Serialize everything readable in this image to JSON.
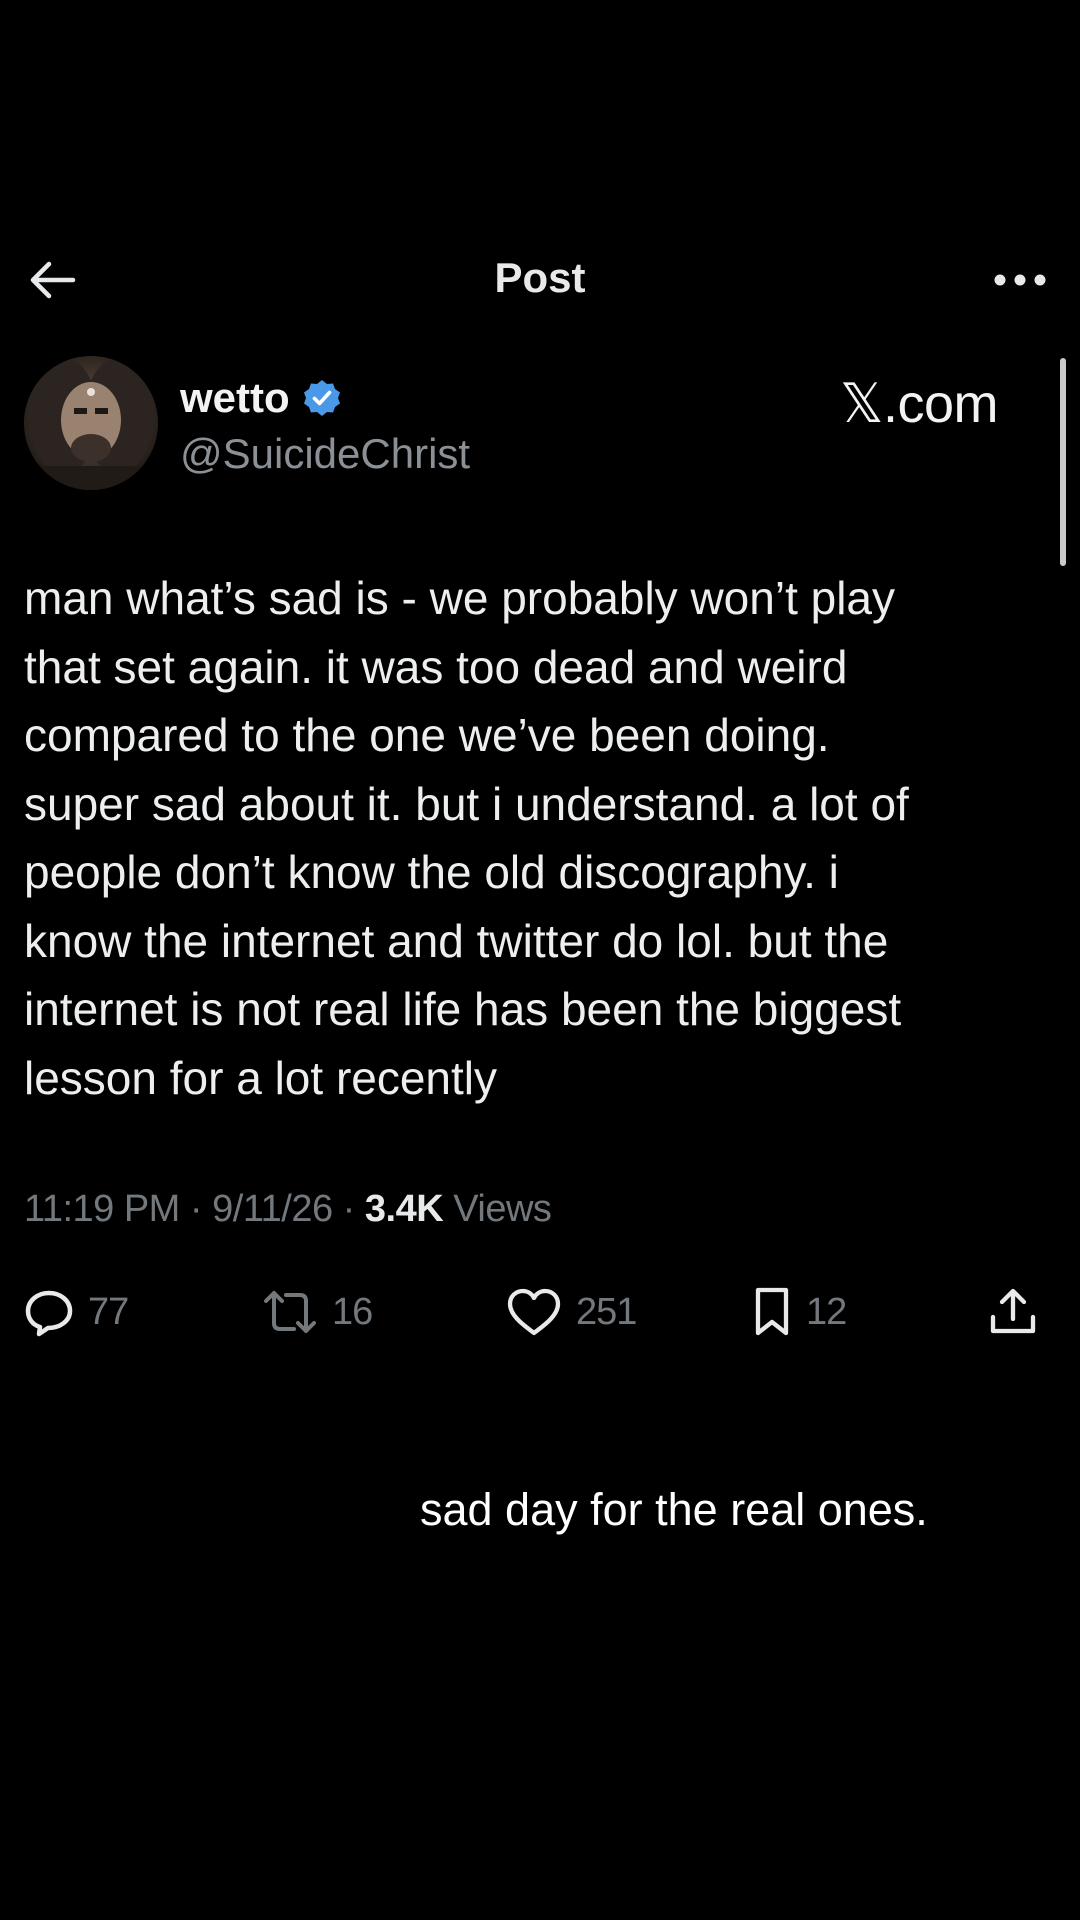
{
  "header": {
    "back_icon": "arrow-left-icon",
    "title": "Post",
    "more_icon": "more-horizontal-icon"
  },
  "author": {
    "display_name": "wetto",
    "verified_icon": "verified-badge-icon",
    "verified_color": "#4a99e9",
    "handle": "@SuicideChrist"
  },
  "site_label": "𝕏.com",
  "post": {
    "text": "man what’s sad is - we probably won’t play\nthat set again. it was too dead and weird\ncompared to the one we’ve been doing.\nsuper sad about it. but i understand. a lot of\npeople don’t know the old discography. i\nknow the internet and twitter do lol. but the\ninternet is not real life has been the biggest\nlesson for a lot recently",
    "time": "11:19 PM",
    "separator": "·",
    "date": "9/11/26",
    "views_count": "3.4K",
    "views_label": "Views"
  },
  "actions": {
    "reply": {
      "icon": "reply-icon",
      "count": "77"
    },
    "repost": {
      "icon": "repost-icon",
      "count": "16"
    },
    "like": {
      "icon": "heart-icon",
      "count": "251"
    },
    "bookmark": {
      "icon": "bookmark-icon",
      "count": "12"
    },
    "share": {
      "icon": "share-icon"
    }
  },
  "caption": "sad day for the real ones.",
  "colors": {
    "background": "#000000",
    "text_primary": "#e7e9ea",
    "text_secondary": "#73787d"
  }
}
